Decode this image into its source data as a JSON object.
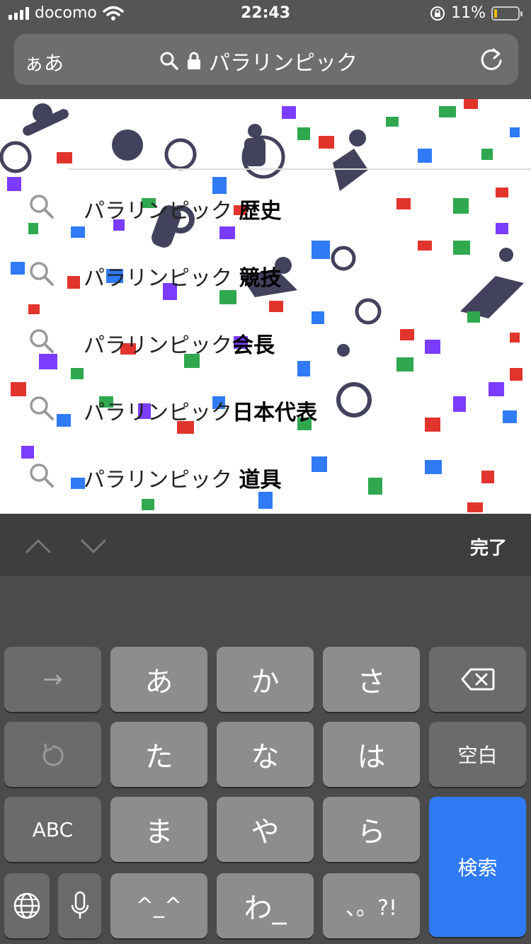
{
  "status": {
    "carrier": "docomo",
    "time": "22:43",
    "battery_percent_text": "11%",
    "battery_level": 0.11
  },
  "urlbar": {
    "aa_label": "ぁあ",
    "query": "パラリンピック"
  },
  "suggestions": {
    "items": [
      {
        "prefix": "パラリンピック ",
        "suffix": "歴史"
      },
      {
        "prefix": "パラリンピック ",
        "suffix": "競技"
      },
      {
        "prefix": "パラリンピック",
        "suffix": "会長"
      },
      {
        "prefix": "パラリンピック",
        "suffix": "日本代表"
      },
      {
        "prefix": "パラリンピック ",
        "suffix": "道具"
      }
    ]
  },
  "accessory": {
    "done_label": "完了"
  },
  "keyboard": {
    "row1": [
      "あ",
      "か",
      "さ"
    ],
    "row2": [
      "た",
      "な",
      "は"
    ],
    "row3": [
      "ま",
      "や",
      "ら"
    ],
    "row4": [
      "^_^",
      "わ_",
      "、。?!"
    ],
    "space_label": "空白",
    "abc_label": "ABC",
    "search_label": "検索",
    "arrow_label": "→"
  },
  "colors": {
    "accent_blue": "#2f7af5",
    "battery_yellow": "#f2c200"
  }
}
